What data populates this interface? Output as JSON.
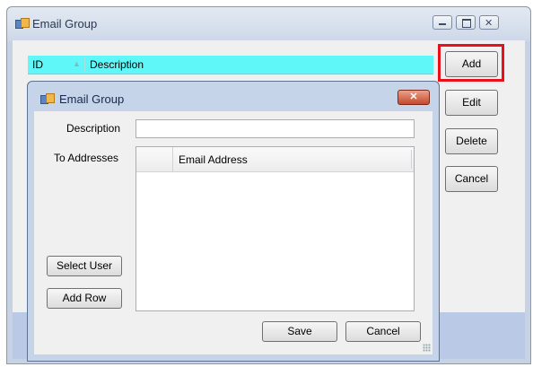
{
  "outer_window": {
    "title": "Email Group",
    "icon": "app-window-icon",
    "controls": [
      "minimize-icon",
      "maximize-icon",
      "close-icon"
    ]
  },
  "grid": {
    "columns": [
      "ID",
      "Description"
    ],
    "sort_glyph": "▲"
  },
  "side_buttons": {
    "add": "Add",
    "edit": "Edit",
    "delete": "Delete",
    "cancel": "Cancel"
  },
  "dialog": {
    "title": "Email Group",
    "close_glyph": "✕",
    "description_label": "Description",
    "description_value": "",
    "to_addresses_label": "To Addresses",
    "address_column": "Email Address",
    "select_user": "Select User",
    "add_row": "Add Row",
    "save": "Save",
    "cancel": "Cancel"
  },
  "colors": {
    "header_cyan": "#5ff7f7",
    "highlight_red": "#e8101a",
    "close_red": "#c54a2d"
  }
}
